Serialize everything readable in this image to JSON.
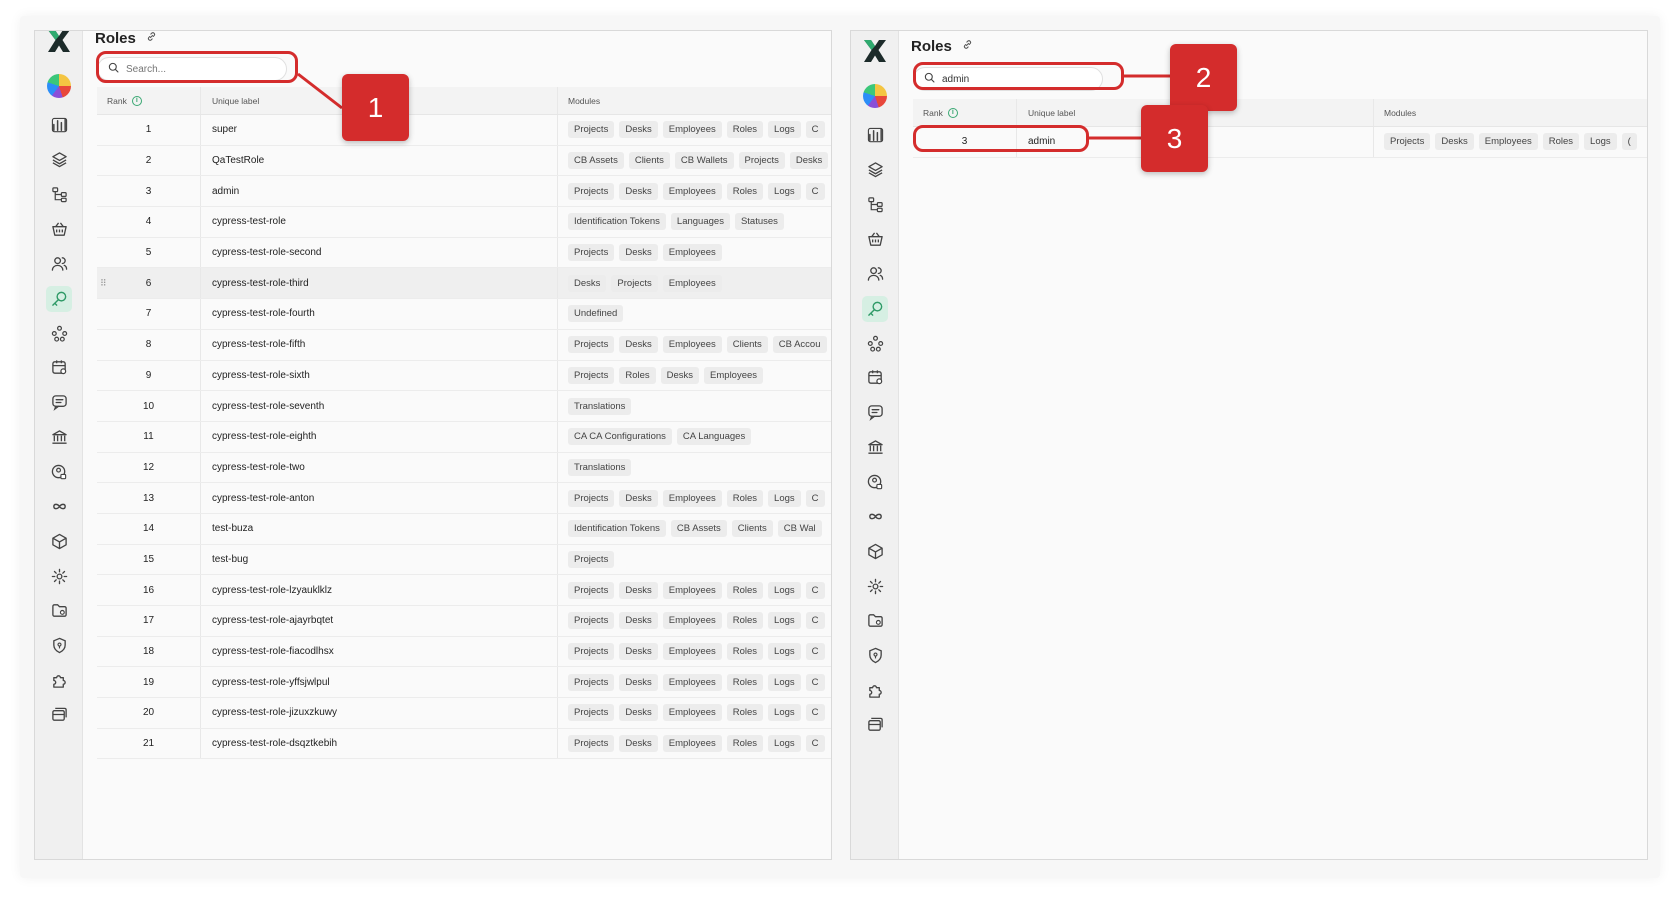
{
  "left_panel": {
    "title": "Roles",
    "search": {
      "placeholder": "Search...",
      "value": ""
    },
    "columns": {
      "rank": "Rank",
      "label": "Unique label",
      "modules": "Modules"
    },
    "rows": [
      {
        "rank": "1",
        "label": "super",
        "modules": [
          "Projects",
          "Desks",
          "Employees",
          "Roles",
          "Logs",
          "C"
        ]
      },
      {
        "rank": "2",
        "label": "QaTestRole",
        "modules": [
          "CB Assets",
          "Clients",
          "CB Wallets",
          "Projects",
          "Desks"
        ]
      },
      {
        "rank": "3",
        "label": "admin",
        "modules": [
          "Projects",
          "Desks",
          "Employees",
          "Roles",
          "Logs",
          "C"
        ]
      },
      {
        "rank": "4",
        "label": "cypress-test-role",
        "modules": [
          "Identification Tokens",
          "Languages",
          "Statuses"
        ]
      },
      {
        "rank": "5",
        "label": "cypress-test-role-second",
        "modules": [
          "Projects",
          "Desks",
          "Employees"
        ]
      },
      {
        "rank": "6",
        "label": "cypress-test-role-third",
        "modules": [
          "Desks",
          "Projects",
          "Employees"
        ]
      },
      {
        "rank": "7",
        "label": "cypress-test-role-fourth",
        "modules": [
          "Undefined"
        ]
      },
      {
        "rank": "8",
        "label": "cypress-test-role-fifth",
        "modules": [
          "Projects",
          "Desks",
          "Employees",
          "Clients",
          "CB Accou"
        ]
      },
      {
        "rank": "9",
        "label": "cypress-test-role-sixth",
        "modules": [
          "Projects",
          "Roles",
          "Desks",
          "Employees"
        ]
      },
      {
        "rank": "10",
        "label": "cypress-test-role-seventh",
        "modules": [
          "Translations"
        ]
      },
      {
        "rank": "11",
        "label": "cypress-test-role-eighth",
        "modules": [
          "CA CA Configurations",
          "CA Languages"
        ]
      },
      {
        "rank": "12",
        "label": "cypress-test-role-two",
        "modules": [
          "Translations"
        ]
      },
      {
        "rank": "13",
        "label": "cypress-test-role-anton",
        "modules": [
          "Projects",
          "Desks",
          "Employees",
          "Roles",
          "Logs",
          "C"
        ]
      },
      {
        "rank": "14",
        "label": "test-buza",
        "modules": [
          "Identification Tokens",
          "CB Assets",
          "Clients",
          "CB Wal"
        ]
      },
      {
        "rank": "15",
        "label": "test-bug",
        "modules": [
          "Projects"
        ]
      },
      {
        "rank": "16",
        "label": "cypress-test-role-lzyauklklz",
        "modules": [
          "Projects",
          "Desks",
          "Employees",
          "Roles",
          "Logs",
          "C"
        ]
      },
      {
        "rank": "17",
        "label": "cypress-test-role-ajayrbqtet",
        "modules": [
          "Projects",
          "Desks",
          "Employees",
          "Roles",
          "Logs",
          "C"
        ]
      },
      {
        "rank": "18",
        "label": "cypress-test-role-fiacodlhsx",
        "modules": [
          "Projects",
          "Desks",
          "Employees",
          "Roles",
          "Logs",
          "C"
        ]
      },
      {
        "rank": "19",
        "label": "cypress-test-role-yffsjwlpul",
        "modules": [
          "Projects",
          "Desks",
          "Employees",
          "Roles",
          "Logs",
          "C"
        ]
      },
      {
        "rank": "20",
        "label": "cypress-test-role-jizuxzkuwy",
        "modules": [
          "Projects",
          "Desks",
          "Employees",
          "Roles",
          "Logs",
          "C"
        ]
      },
      {
        "rank": "21",
        "label": "cypress-test-role-dsqztkebih",
        "modules": [
          "Projects",
          "Desks",
          "Employees",
          "Roles",
          "Logs",
          "C"
        ]
      }
    ]
  },
  "right_panel": {
    "title": "Roles",
    "search": {
      "placeholder": "Search...",
      "value": "admin"
    },
    "columns": {
      "rank": "Rank",
      "label": "Unique label",
      "modules": "Modules"
    },
    "rows": [
      {
        "rank": "3",
        "label": "admin",
        "modules": [
          "Projects",
          "Desks",
          "Employees",
          "Roles",
          "Logs",
          "("
        ]
      }
    ]
  },
  "sidebar_icons": [
    "logo-x",
    "color-wheel-icon",
    "bar-chart-icon",
    "layers-icon",
    "hierarchy-icon",
    "basket-icon",
    "users-icon",
    "key-icon",
    "network-icon",
    "calendar-settings-icon",
    "chat-icon",
    "bank-icon",
    "user-lock-icon",
    "infinity-icon",
    "cube-icon",
    "gear-icon",
    "folder-icon",
    "shield-icon",
    "puzzle-icon",
    "cards-icon"
  ],
  "callouts": [
    "1",
    "2",
    "3"
  ],
  "colors": {
    "callout": "#d42c2c",
    "active": "#3aa873",
    "active_bg": "#d6efe3"
  }
}
